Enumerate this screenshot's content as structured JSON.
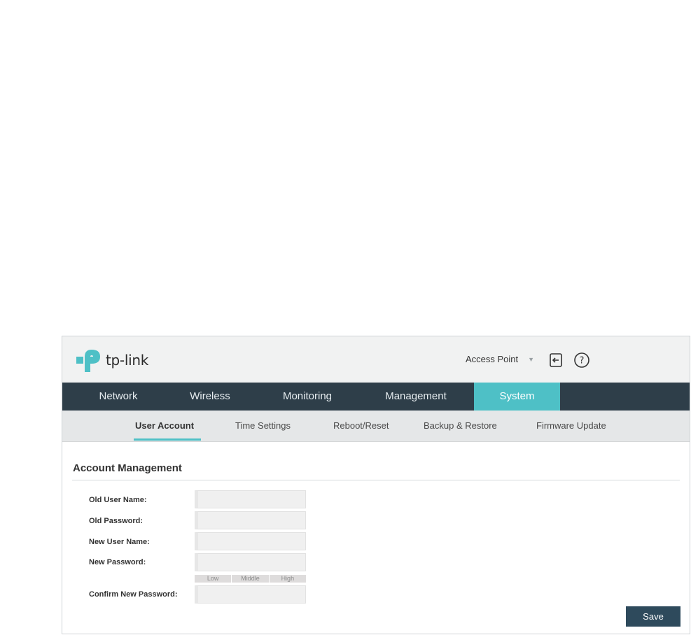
{
  "header": {
    "brand": "tp-link",
    "mode_label": "Access Point",
    "icons": [
      "logout-icon",
      "help-icon"
    ]
  },
  "nav": {
    "items": [
      "Network",
      "Wireless",
      "Monitoring",
      "Management",
      "System"
    ],
    "active": "System"
  },
  "subnav": {
    "items": [
      "User Account",
      "Time Settings",
      "Reboot/Reset",
      "Backup & Restore",
      "Firmware Update"
    ],
    "active": "User Account"
  },
  "section": {
    "title": "Account Management"
  },
  "form": {
    "old_user_name_label": "Old User Name:",
    "old_user_name_value": "",
    "old_password_label": "Old Password:",
    "old_password_value": "",
    "new_user_name_label": "New User Name:",
    "new_user_name_value": "",
    "new_password_label": "New Password:",
    "new_password_value": "",
    "strength_levels": [
      "Low",
      "Middle",
      "High"
    ],
    "confirm_password_label": "Confirm New Password:",
    "confirm_password_value": ""
  },
  "actions": {
    "save_label": "Save"
  },
  "colors": {
    "nav_bg": "#2e3e49",
    "accent": "#4ec0c6",
    "button_bg": "#2e4a5c",
    "header_bg": "#f1f2f2",
    "subnav_bg": "#e5e7e8"
  }
}
